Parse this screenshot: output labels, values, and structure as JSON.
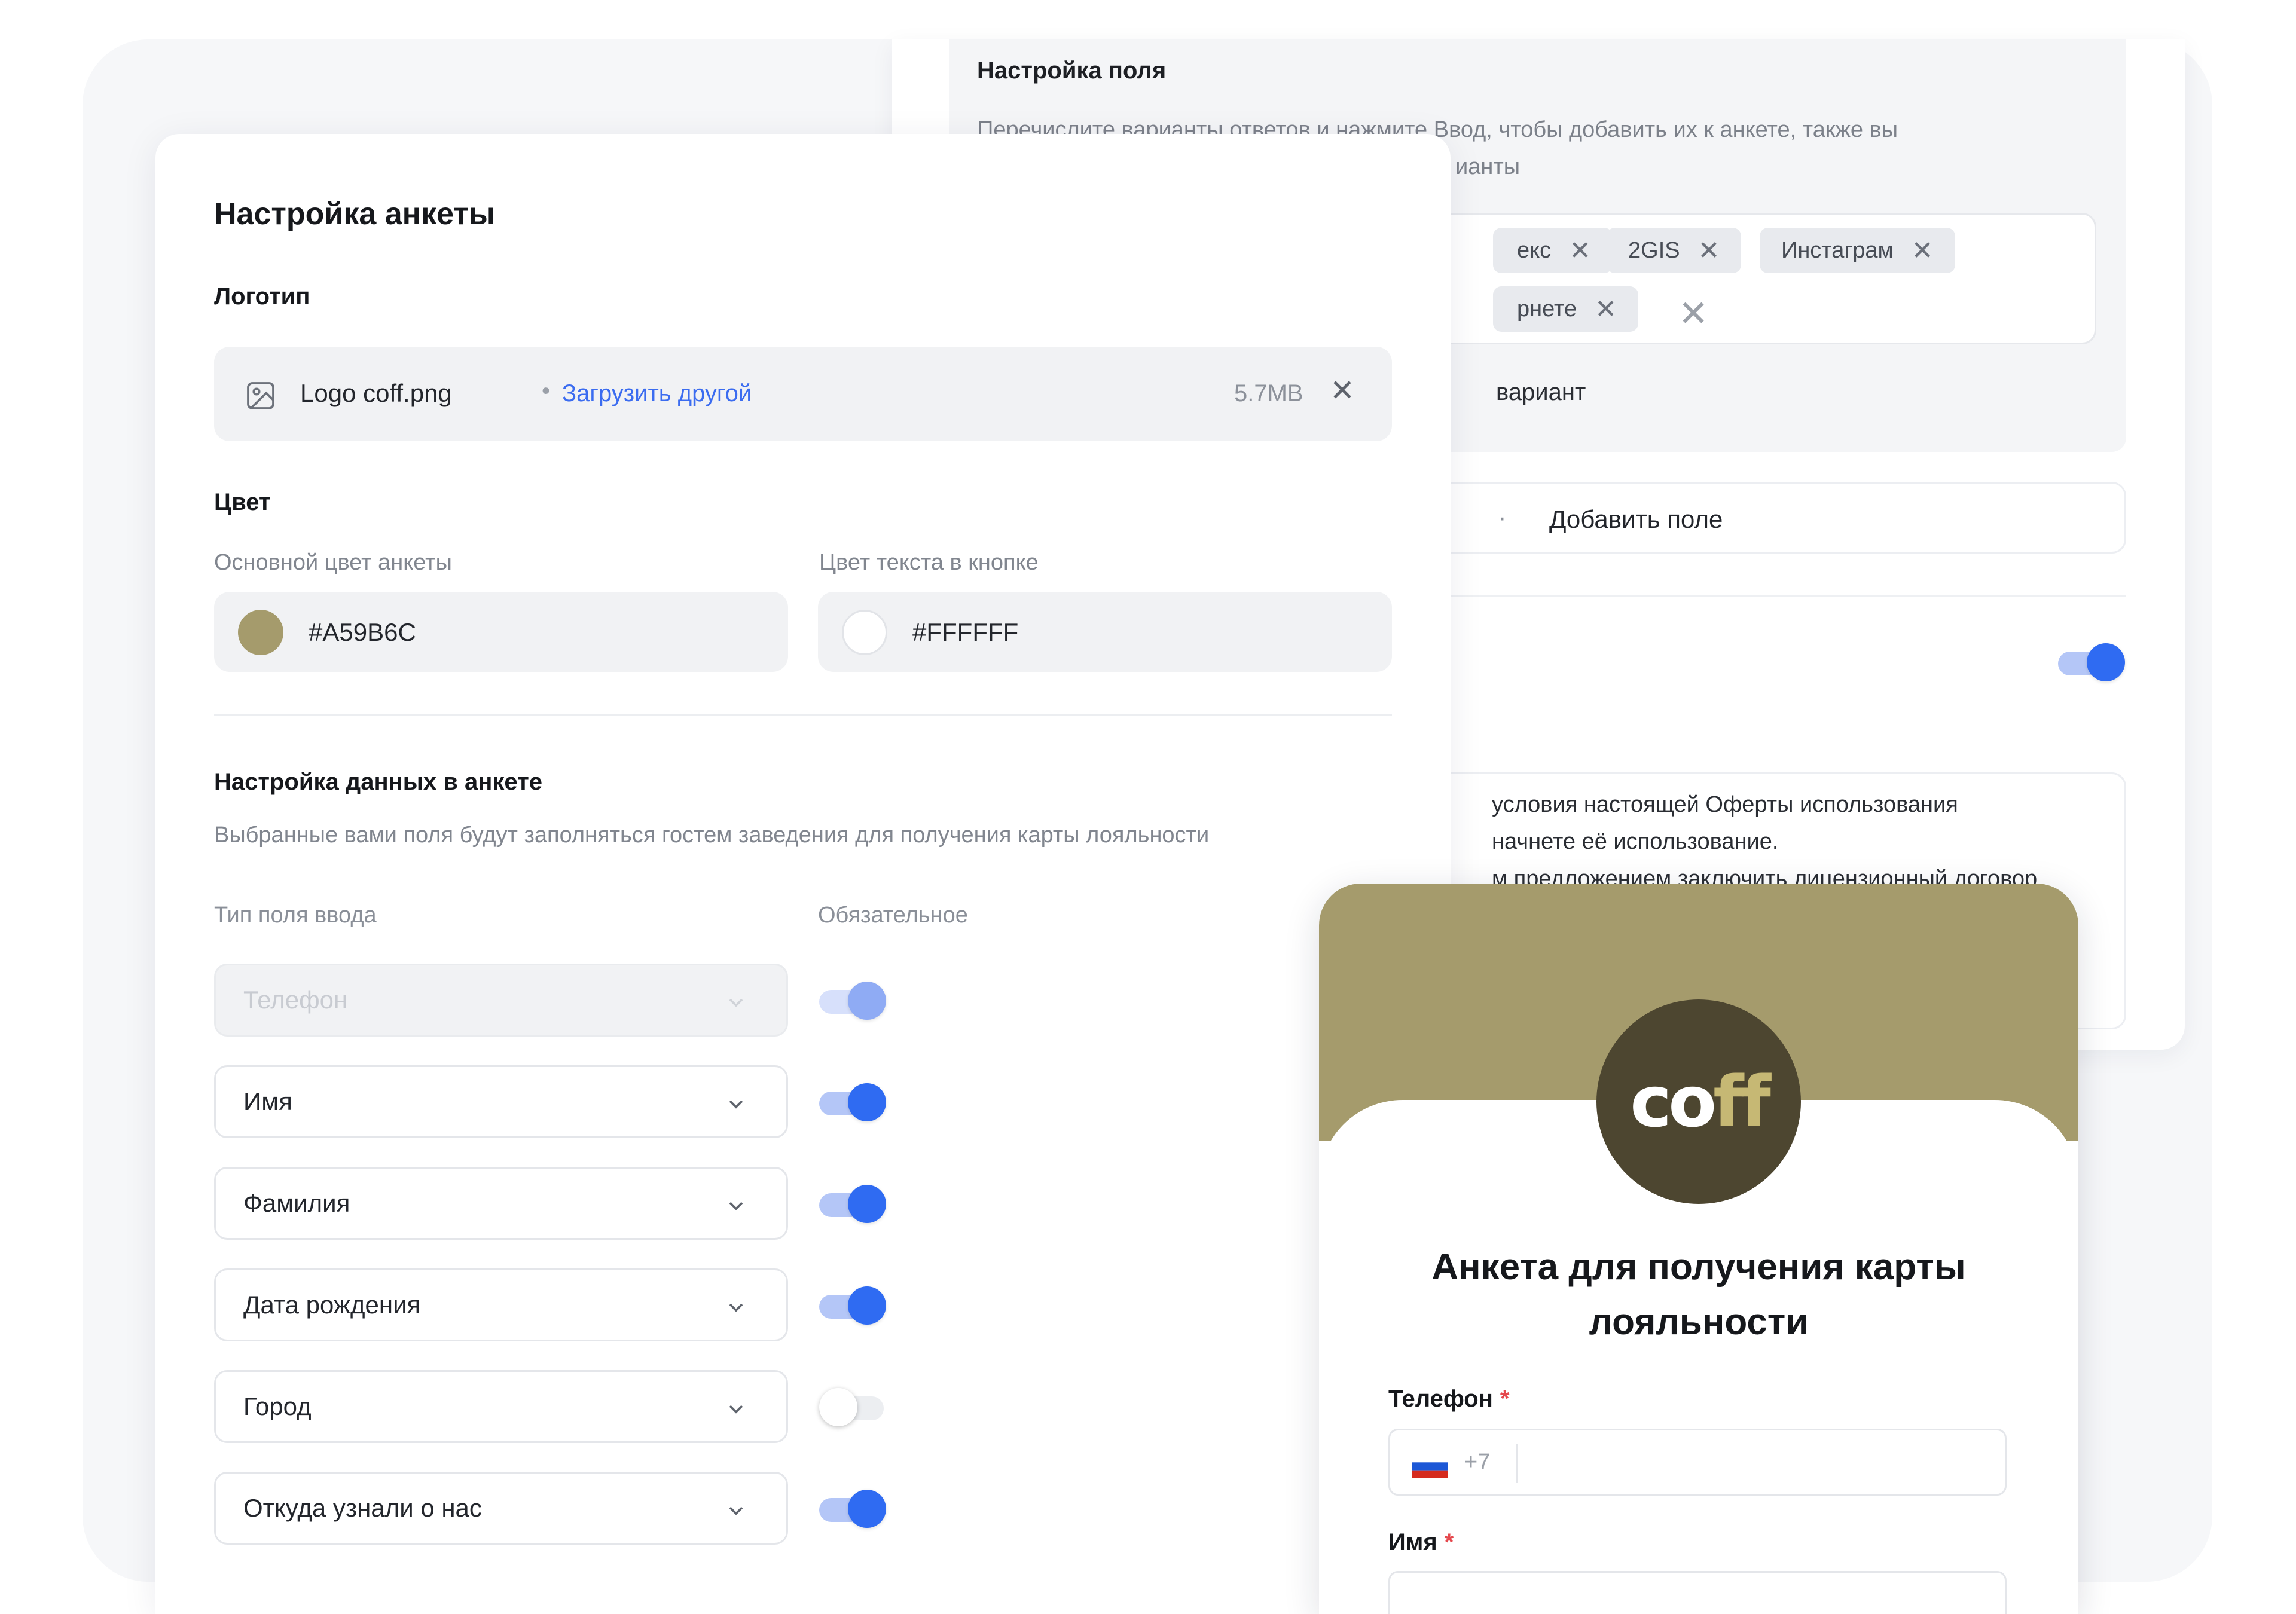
{
  "field_settings": {
    "title": "Настройка поля",
    "description": "Перечислите варианты ответов и нажмите Ввод, чтобы добавить их к анкете, также вы",
    "description_line2": "ианты",
    "tags": [
      {
        "label": "екс"
      },
      {
        "label": "2GIS"
      },
      {
        "label": "Инстаграм"
      },
      {
        "label": "рнете"
      }
    ],
    "variant_label": "вариант",
    "add_field_label": "Добавить поле",
    "offer_lines": [
      "условия настоящей Оферты использования",
      "начнете её использование.",
      "м предложением заключить лицензионный договор"
    ]
  },
  "survey": {
    "title": "Настройка анкеты",
    "logo": {
      "heading": "Логотип",
      "file_name": "Logo coff.png",
      "separator": "•",
      "upload_other": "Загрузить другой",
      "file_size": "5.7MB"
    },
    "color": {
      "heading": "Цвет",
      "primary_label": "Основной цвет анкеты",
      "primary_value": "#A59B6C",
      "button_text_label": "Цвет текста в кнопке",
      "button_text_value": "#FFFFFF"
    },
    "data_settings": {
      "heading": "Настройка данных в анкете",
      "description": "Выбранные вами поля будут заполняться гостем заведения для получения карты лояльности",
      "col_type": "Тип поля ввода",
      "col_required": "Обязательное",
      "fields": [
        {
          "label": "Телефон",
          "required": true,
          "disabled": true
        },
        {
          "label": "Имя",
          "required": true,
          "disabled": false
        },
        {
          "label": "Фамилия",
          "required": true,
          "disabled": false
        },
        {
          "label": "Дата рождения",
          "required": true,
          "disabled": false
        },
        {
          "label": "Город",
          "required": false,
          "disabled": false
        },
        {
          "label": "Откуда узнали о нас",
          "required": true,
          "disabled": false
        }
      ]
    }
  },
  "preview": {
    "logo_text_a": "co",
    "logo_text_b": "ff",
    "title": "Анкета для получения карты лояльности",
    "phone_label": "Телефон",
    "required_mark": "*",
    "country_code": "+7",
    "name_label": "Имя"
  },
  "colors": {
    "brand": "#A59B6C",
    "accent_blue": "#2F6BF2",
    "link": "#3B6CF0",
    "required_red": "#E5484D"
  }
}
